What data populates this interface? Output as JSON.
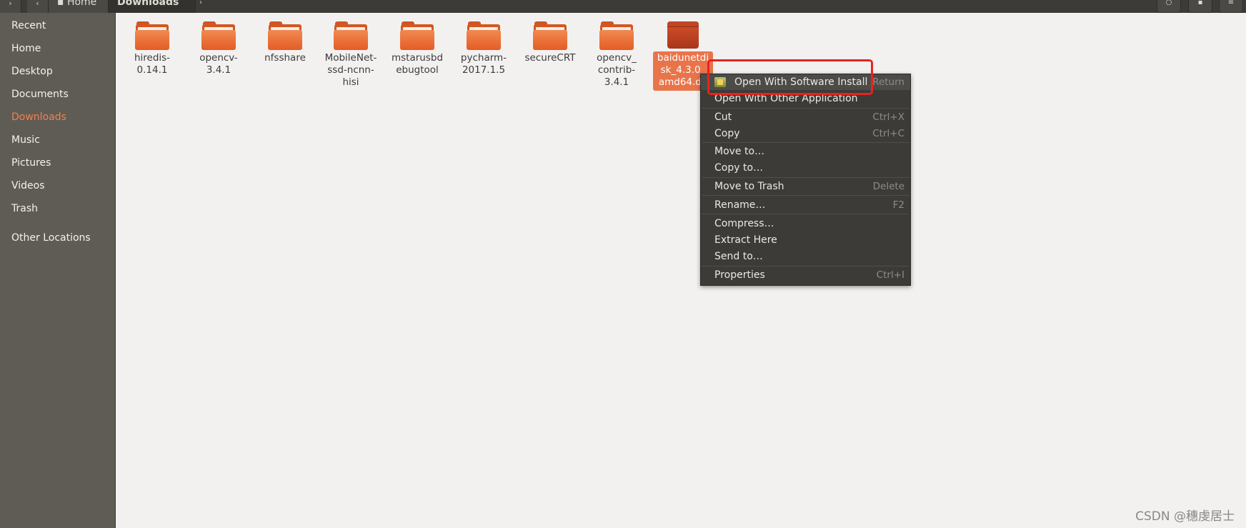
{
  "header": {
    "breadcrumbs": [
      "Home",
      "Downloads"
    ]
  },
  "sidebar": {
    "items": [
      {
        "label": "Recent"
      },
      {
        "label": "Home"
      },
      {
        "label": "Desktop"
      },
      {
        "label": "Documents"
      },
      {
        "label": "Downloads"
      },
      {
        "label": "Music"
      },
      {
        "label": "Pictures"
      },
      {
        "label": "Videos"
      },
      {
        "label": "Trash"
      },
      {
        "label": "Other Locations"
      }
    ]
  },
  "files": [
    {
      "name": "hiredis-\n0.14.1",
      "kind": "folder"
    },
    {
      "name": "opencv-\n3.4.1",
      "kind": "folder"
    },
    {
      "name": "nfsshare",
      "kind": "folder"
    },
    {
      "name": "MobileNet-\nssd-ncnn-\nhisi",
      "kind": "folder"
    },
    {
      "name": "mstarusbd\nebugtool",
      "kind": "folder"
    },
    {
      "name": "pycharm-\n2017.1.5",
      "kind": "folder"
    },
    {
      "name": "secureCRT",
      "kind": "folder"
    },
    {
      "name": "opencv_\ncontrib-\n3.4.1",
      "kind": "folder"
    },
    {
      "name": "baidunetdi\nsk_4.3.0_\namd64.de",
      "kind": "package"
    }
  ],
  "context_menu": {
    "items": [
      {
        "label": "Open With Software Install",
        "shortcut": "Return"
      },
      {
        "label": "Open With Other Application",
        "shortcut": ""
      },
      {
        "label": "Cut",
        "shortcut": "Ctrl+X"
      },
      {
        "label": "Copy",
        "shortcut": "Ctrl+C"
      },
      {
        "label": "Move to…",
        "shortcut": ""
      },
      {
        "label": "Copy to…",
        "shortcut": ""
      },
      {
        "label": "Move to Trash",
        "shortcut": "Delete"
      },
      {
        "label": "Rename…",
        "shortcut": "F2"
      },
      {
        "label": "Compress…",
        "shortcut": ""
      },
      {
        "label": "Extract Here",
        "shortcut": ""
      },
      {
        "label": "Send to…",
        "shortcut": ""
      },
      {
        "label": "Properties",
        "shortcut": "Ctrl+I"
      }
    ]
  },
  "colors": {
    "accent": "#e9744a",
    "annotation": "#e8231e"
  },
  "watermark": "CSDN @穗虔居士"
}
